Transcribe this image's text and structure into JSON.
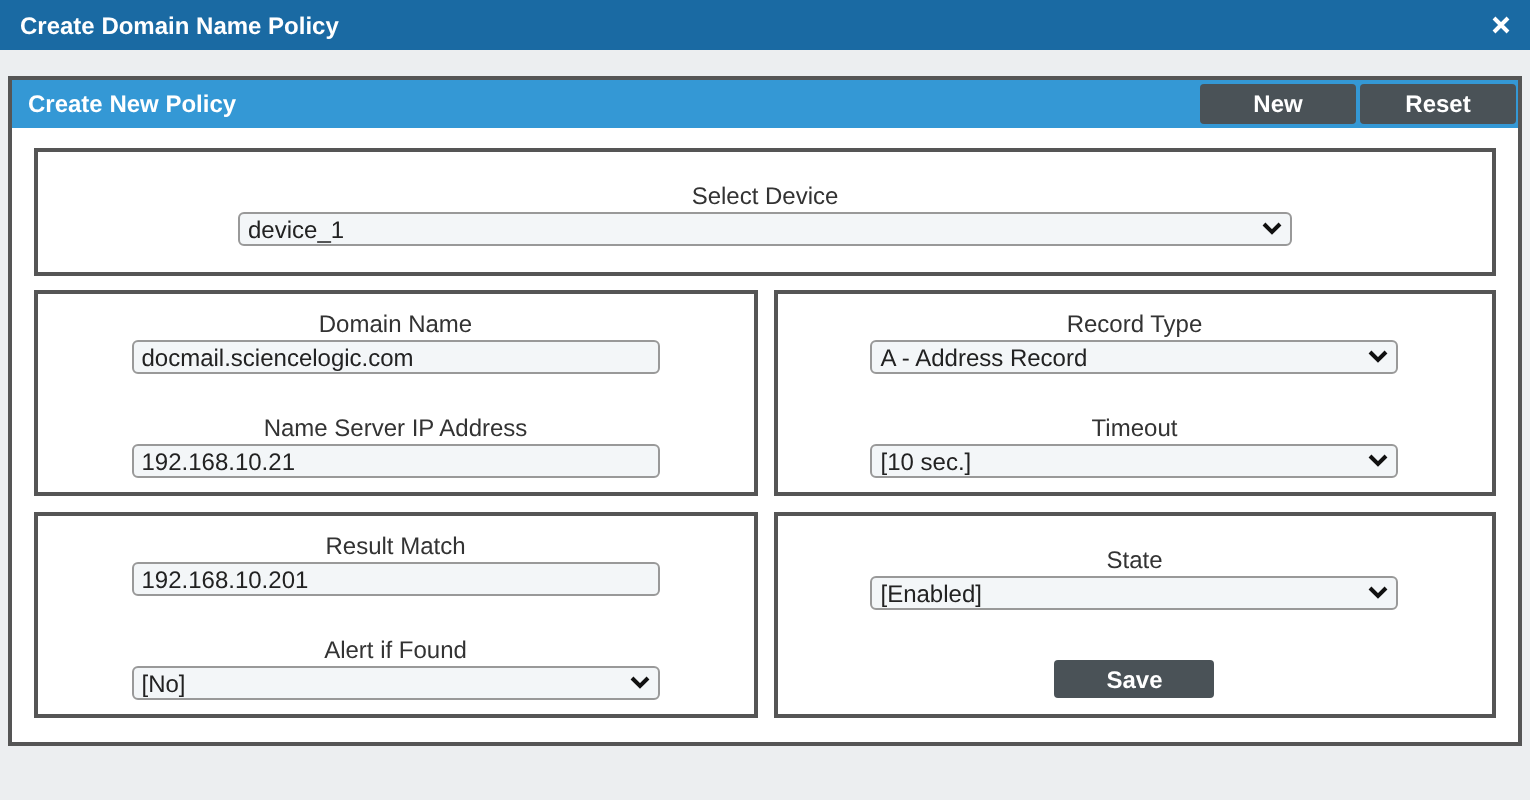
{
  "window": {
    "title": "Create Domain Name Policy"
  },
  "panel": {
    "title": "Create New Policy",
    "buttons": [
      "New",
      "Reset"
    ]
  },
  "device_section": {
    "fields": [
      {
        "label": "Select Device",
        "kind": "select",
        "value": "device_1"
      }
    ]
  },
  "sections": [
    {
      "fields": [
        {
          "label": "Domain Name",
          "kind": "text",
          "value": "docmail.sciencelogic.com"
        },
        {
          "label": "Name Server IP Address",
          "kind": "text",
          "value": "192.168.10.21"
        }
      ]
    },
    {
      "fields": [
        {
          "label": "Record Type",
          "kind": "select",
          "value": "A - Address Record"
        },
        {
          "label": "Timeout",
          "kind": "select",
          "value": "[10 sec.]"
        }
      ]
    },
    {
      "fields": [
        {
          "label": "Result Match",
          "kind": "text",
          "value": "192.168.10.201"
        },
        {
          "label": "Alert if Found",
          "kind": "select",
          "value": "[No]"
        }
      ]
    },
    {
      "fields": [
        {
          "label": "State",
          "kind": "select",
          "value": "[Enabled]"
        }
      ],
      "button": "Save"
    }
  ]
}
